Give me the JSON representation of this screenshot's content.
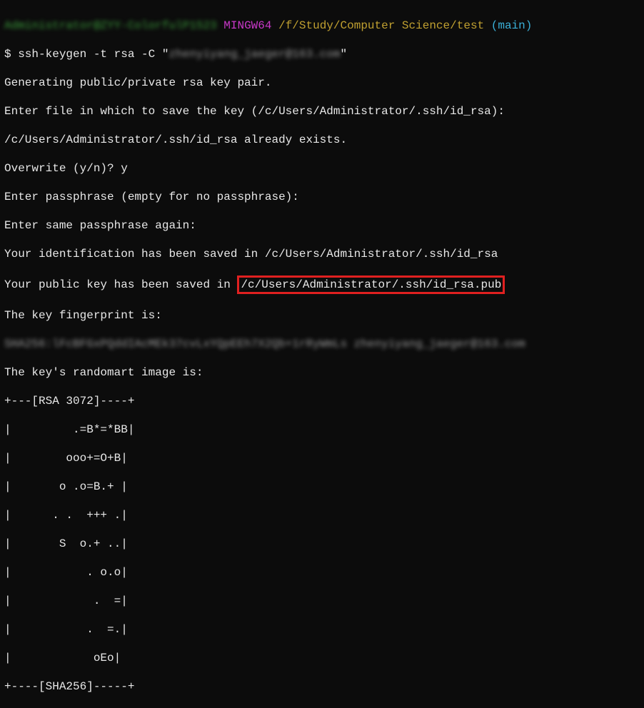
{
  "prompt": {
    "user_host": "Administrator@ZYY-ColorfulP1523",
    "env": "MINGW64",
    "path": "/f/Study/Computer Science/test",
    "branch": "(main)"
  },
  "command": {
    "prefix": "$ ",
    "cmd": "ssh-keygen -t rsa -C \"",
    "blurred_arg": "zhenyiyang_jaeger@163.com",
    "suffix": "\""
  },
  "output": {
    "line1": "Generating public/private rsa key pair.",
    "line2": "Enter file in which to save the key (/c/Users/Administrator/.ssh/id_rsa):",
    "line3": "/c/Users/Administrator/.ssh/id_rsa already exists.",
    "line4": "Overwrite (y/n)? y",
    "line5": "Enter passphrase (empty for no passphrase):",
    "line6": "Enter same passphrase again:",
    "line7": "Your identification has been saved in /c/Users/Administrator/.ssh/id_rsa",
    "line8_prefix": "Your public key has been saved in ",
    "line8_highlight": "/c/Users/Administrator/.ssh/id_rsa.pub",
    "line9": "The key fingerprint is:",
    "fingerprint_blurred": "SHA256:lFcBFGxPQddIAcMEk37cvLxYQpEEh7X2Qb+1rRyWmLs zhenyiyang_jaeger@163.com",
    "line11": "The key's randomart image is:",
    "randomart": [
      "+---[RSA 3072]----+",
      "|         .=B*=*BB|",
      "|        ooo+=O+B|",
      "|       o .o=B.+ |",
      "|      . .  +++ .|",
      "|       S  o.+ ..|",
      "|           . o.o|",
      "|            .  =|",
      "|           .  =.|",
      "|            oEo|",
      "+----[SHA256]-----+"
    ]
  }
}
